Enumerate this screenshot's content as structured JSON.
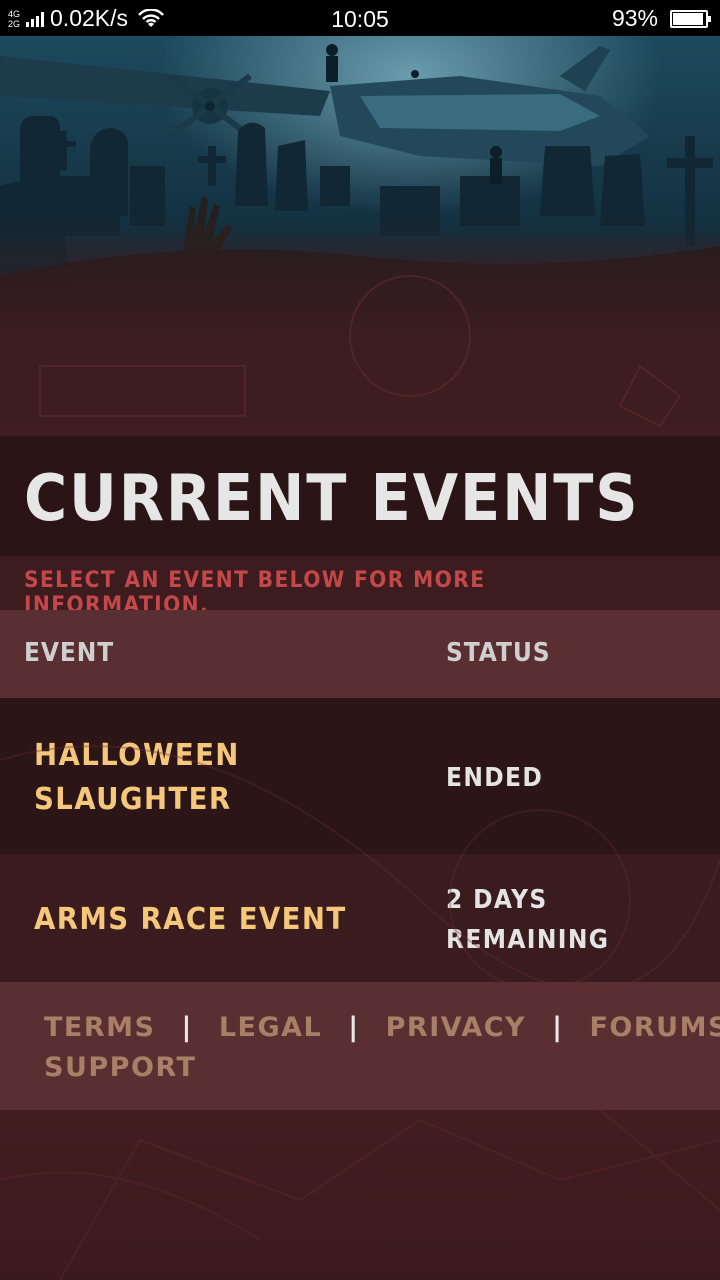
{
  "status_bar": {
    "network_top": "4G",
    "network_bottom": "2G",
    "speed": "0.02K/s",
    "time": "10:05",
    "battery": "93%",
    "battery_level": 0.93
  },
  "page": {
    "title": "CURRENT EVENTS",
    "subtitle": "SELECT AN EVENT BELOW FOR MORE INFORMATION."
  },
  "table": {
    "headers": {
      "event": "EVENT",
      "status": "STATUS"
    },
    "rows": [
      {
        "event_line1": "HALLOWEEN",
        "event_line2": "SLAUGHTER",
        "status_line1": "ENDED",
        "status_line2": ""
      },
      {
        "event_line1": "ARMS RACE EVENT",
        "event_line2": "",
        "status_line1": "2 DAYS",
        "status_line2": "REMAINING"
      }
    ]
  },
  "footer": {
    "links": [
      "TERMS",
      "LEGAL",
      "PRIVACY",
      "FORUMS",
      "SUPPORT"
    ],
    "separator": "|"
  },
  "colors": {
    "title": "#e6e6e6",
    "subtitle": "#c4474a",
    "event_name": "#f5c77a",
    "footer_link": "#a88068"
  }
}
